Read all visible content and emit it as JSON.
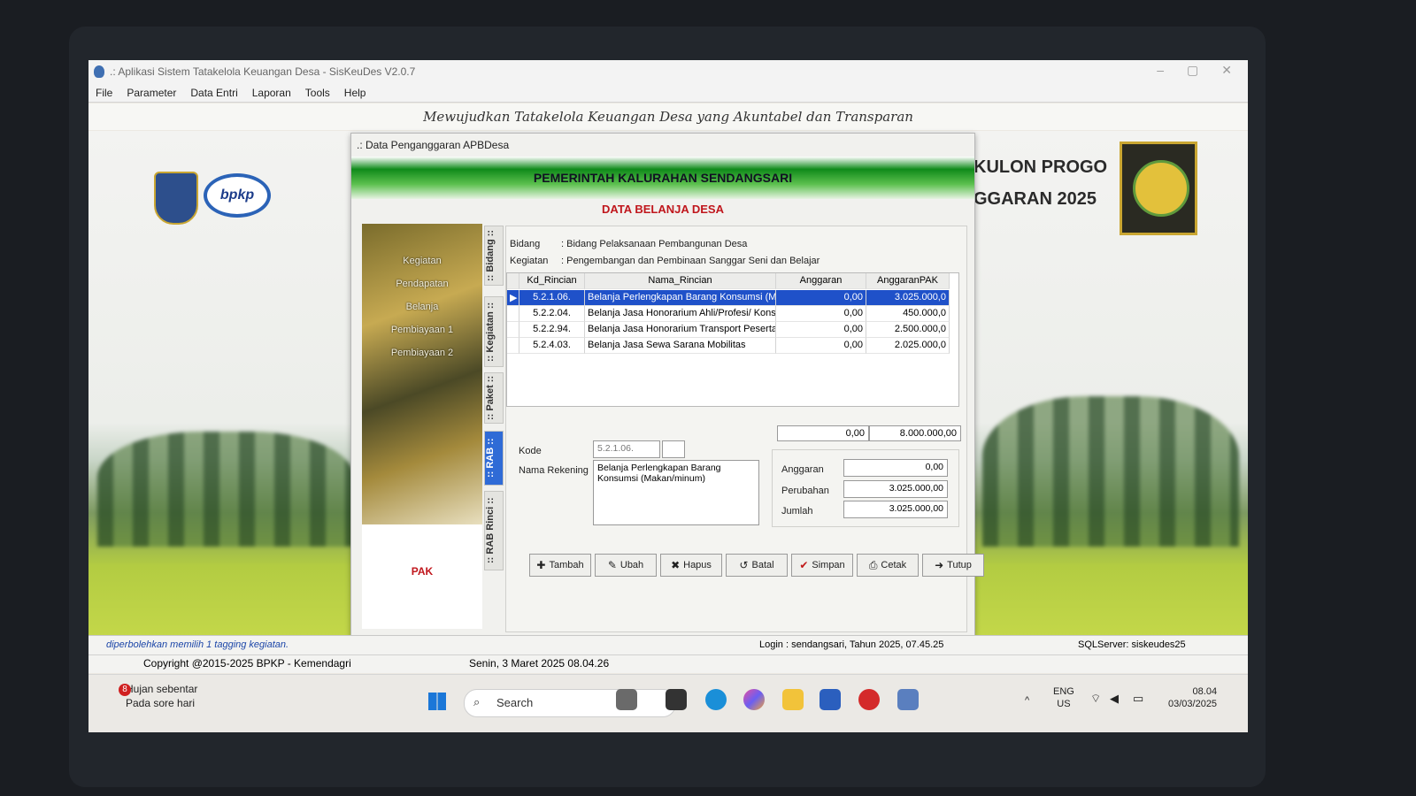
{
  "window": {
    "title": ".: Aplikasi Sistem Tatakelola Keuangan Desa - SisKeuDes V2.0.7",
    "controls": [
      "–",
      "▢",
      "✕"
    ],
    "menu": [
      "File",
      "Parameter",
      "Data Entri",
      "Laporan",
      "Tools",
      "Help"
    ],
    "banner": "Mewujudkan Tatakelola Keuangan Desa yang Akuntabel dan Transparan",
    "logo_text": "bpkp",
    "right_title_1": "KULON PROGO",
    "right_title_2": "GGARAN 2025"
  },
  "dialog": {
    "title": ".: Data Penganggaran APBDesa",
    "header": "PEMERINTAH KALURAHAN SENDANGSARI",
    "subheader": "DATA BELANJA DESA",
    "left_menu": [
      "Kegiatan",
      "Pendapatan",
      "Belanja",
      "Pembiayaan 1",
      "Pembiayaan 2"
    ],
    "left_footer": "PAK",
    "tabs": [
      ":: Bidang ::",
      ":: Kegiatan ::",
      ":: Paket ::",
      ":: RAB ::",
      ":: RAB Rinci ::"
    ],
    "bidang_label": "Bidang",
    "bidang_value": ": Bidang Pelaksanaan Pembangunan Desa",
    "kegiatan_label": "Kegiatan",
    "kegiatan_value": ": Pengembangan dan Pembinaan Sanggar Seni dan Belajar",
    "columns": [
      "Kd_Rincian",
      "Nama_Rincian",
      "Anggaran",
      "AnggaranPAK"
    ],
    "rows": [
      {
        "kd": "5.2.1.06.",
        "nama": "Belanja Perlengkapan Barang Konsumsi (Mak",
        "anggaran": "0,00",
        "pak": "3.025.000,0",
        "selected": true
      },
      {
        "kd": "5.2.2.04.",
        "nama": "Belanja Jasa Honorarium Ahli/Profesi/ Konsul",
        "anggaran": "0,00",
        "pak": "450.000,0"
      },
      {
        "kd": "5.2.2.94.",
        "nama": "Belanja Jasa Honorarium Transport Peserta F",
        "anggaran": "0,00",
        "pak": "2.500.000,0"
      },
      {
        "kd": "5.2.4.03.",
        "nama": "Belanja Jasa Sewa Sarana Mobilitas",
        "anggaran": "0,00",
        "pak": "2.025.000,0"
      }
    ],
    "total_anggaran": "0,00",
    "total_pak": "8.000.000,00",
    "kode_label": "Kode",
    "kode_value": "5.2.1.06.",
    "nama_rekening_label": "Nama Rekening",
    "nama_rekening_value": "Belanja Perlengkapan Barang Konsumsi (Makan/minum)",
    "anggaran_label": "Anggaran",
    "anggaran_value": "0,00",
    "perubahan_label": "Perubahan",
    "perubahan_value": "3.025.000,00",
    "jumlah_label": "Jumlah",
    "jumlah_value": "3.025.000,00",
    "buttons": [
      "Tambah",
      "Ubah",
      "Hapus",
      "Batal",
      "Simpan",
      "Cetak",
      "Tutup"
    ]
  },
  "status": {
    "hint": "diperbolehkan memilih 1 tagging kegiatan.",
    "copyright": "Copyright @2015-2025 BPKP - Kemendagri",
    "datetime": "Senin, 3 Maret 2025  08.04.26",
    "login": "Login : sendangsari,  Tahun 2025, 07.45.25",
    "sqlserver": "SQLServer: siskeudes25"
  },
  "taskbar": {
    "weather_badge": "8",
    "weather_title": "Hujan sebentar",
    "weather_sub": "Pada sore hari",
    "search_placeholder": "Search",
    "lang_1": "ENG",
    "lang_2": "US",
    "time": "08.04",
    "date": "03/03/2025"
  }
}
